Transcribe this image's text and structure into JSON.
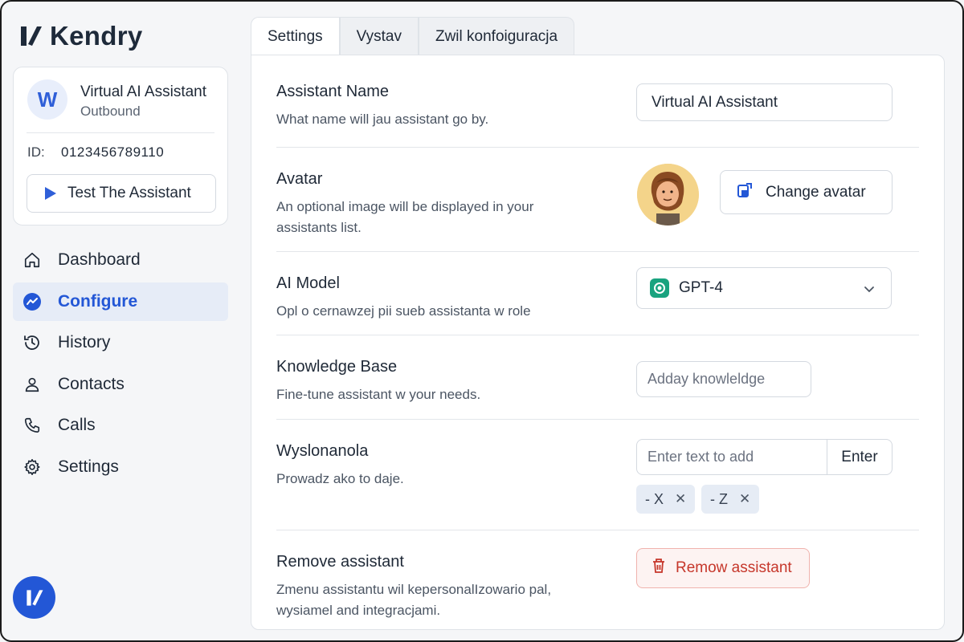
{
  "brand": {
    "name": "Kendry"
  },
  "assistant_card": {
    "avatar_letter": "W",
    "title": "Virtual AI Assistant",
    "subtitle": "Outbound",
    "id_label": "ID:",
    "id_value": "0123456789110",
    "test_button": "Test The Assistant"
  },
  "nav": {
    "items": [
      {
        "label": "Dashboard",
        "icon": "home-icon",
        "active": false
      },
      {
        "label": "Configure",
        "icon": "trend-icon",
        "active": true
      },
      {
        "label": "History",
        "icon": "history-icon",
        "active": false
      },
      {
        "label": "Contacts",
        "icon": "user-icon",
        "active": false
      },
      {
        "label": "Calls",
        "icon": "phone-icon",
        "active": false
      },
      {
        "label": "Settings",
        "icon": "gear-icon",
        "active": false
      }
    ]
  },
  "tabs": [
    {
      "label": "Settings",
      "active": true
    },
    {
      "label": "Vystav",
      "active": false
    },
    {
      "label": "Zwil konfoiguracja",
      "active": false
    }
  ],
  "sections": {
    "name": {
      "title": "Assistant Name",
      "desc": "What name will jau assistant go by.",
      "value": "Virtual AI Assistant"
    },
    "avatar": {
      "title": "Avatar",
      "desc": "An optional image will be displayed in your assistants list.",
      "button": "Change avatar"
    },
    "model": {
      "title": "AI Model",
      "desc": "Opl o cernawzej pii sueb assistanta w role",
      "value": "GPT-4"
    },
    "knowledge": {
      "title": "Knowledge Base",
      "desc": "Fine-tune assistant w your needs.",
      "placeholder": "Adday knowleldge"
    },
    "wyslonanola": {
      "title": "Wyslonanola",
      "desc": "Prowadz ako to daje.",
      "placeholder": "Enter text to add",
      "enter_button": "Enter",
      "tags": [
        "- X",
        "- Z"
      ]
    },
    "remove": {
      "title": "Remove assistant",
      "desc": "Zmenu assistantu wil kepersonalIzowario pal, wysiamel and integracjami.",
      "button": "Remow assistant"
    }
  },
  "colors": {
    "accent": "#2357d6",
    "danger": "#c6372b",
    "avatar_bg": "#f4d48a",
    "gpt": "#19a37f"
  }
}
